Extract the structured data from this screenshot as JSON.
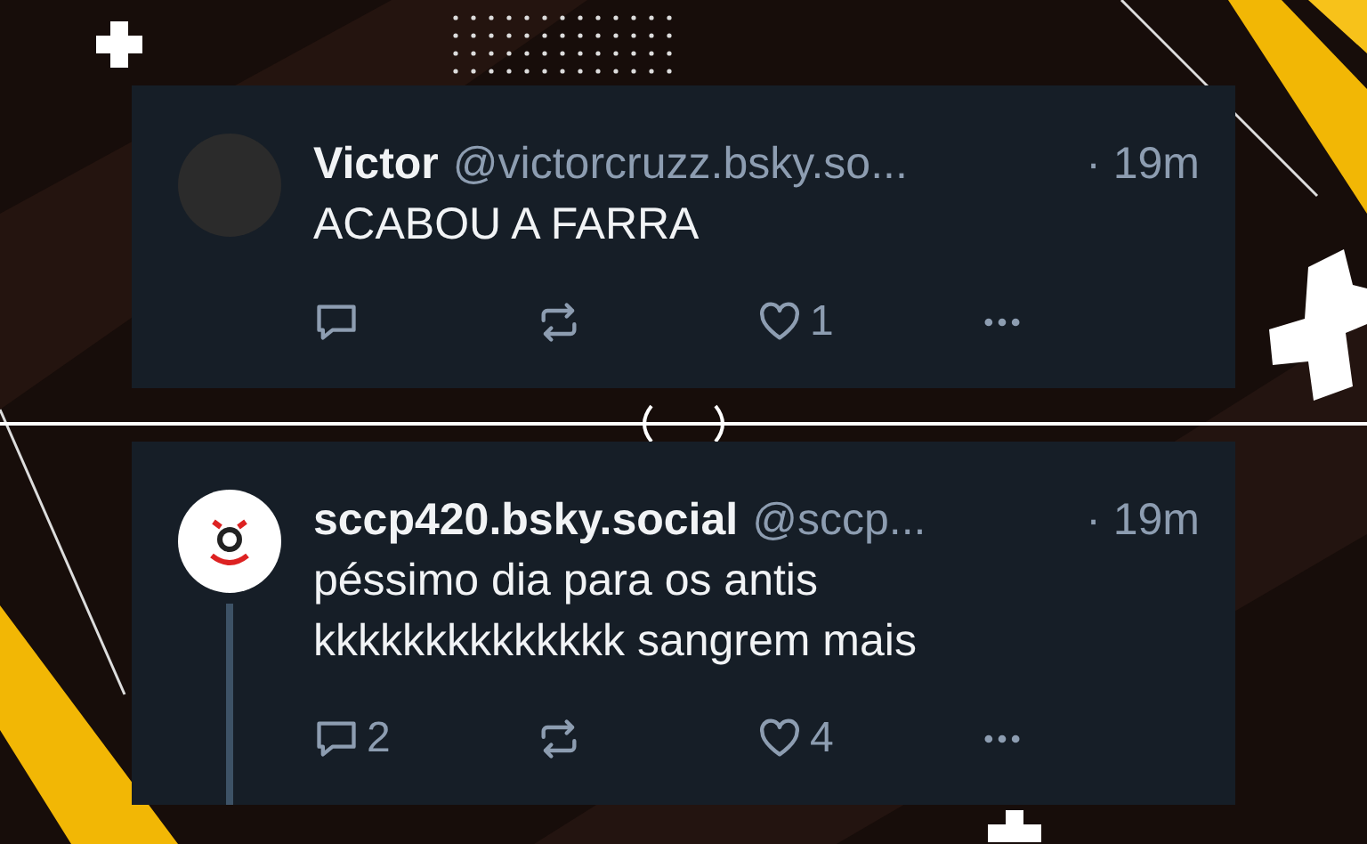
{
  "posts": [
    {
      "avatar": {
        "kind": "photo"
      },
      "display_name": "Victor",
      "handle": "@victorcruzz.bsky.so...",
      "time": "· 19m",
      "text": [
        "ACABOU A FARRA"
      ],
      "like_count": "1",
      "thread_line": false
    },
    {
      "avatar": {
        "kind": "logo"
      },
      "display_name": "sccp420.bsky.social",
      "handle": "@sccp...",
      "time": "· 19m",
      "text": [
        "péssimo dia para os antis",
        "kkkkkkkkkkkkkk sangrem mais"
      ],
      "reply_count": "2",
      "like_count": "4",
      "thread_line": true
    }
  ]
}
